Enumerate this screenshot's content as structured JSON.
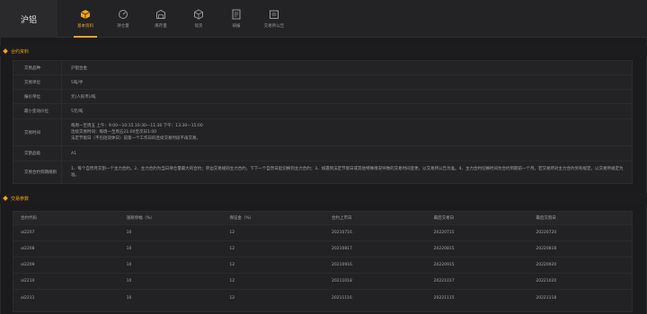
{
  "brand": {
    "title": "沪铝"
  },
  "nav": [
    {
      "label": "基本资料",
      "icon": "cube-icon",
      "active": true
    },
    {
      "label": "持仓量",
      "icon": "gauge-icon",
      "active": false
    },
    {
      "label": "库存量",
      "icon": "warehouse-icon",
      "active": false
    },
    {
      "label": "现货",
      "icon": "box-icon",
      "active": false
    },
    {
      "label": "研报",
      "icon": "document-icon",
      "active": false
    },
    {
      "label": "交易所公告",
      "icon": "notice-icon",
      "active": false
    }
  ],
  "sections": {
    "contract": "合约资料",
    "params": "交易参数"
  },
  "contract_info": [
    {
      "key": "交易品种",
      "value": "沪铝合金"
    },
    {
      "key": "交易单位",
      "value": "5吨/手"
    },
    {
      "key": "报价单位",
      "value": "元(人民币)/吨"
    },
    {
      "key": "最小变动价位",
      "value": "5元/吨"
    },
    {
      "key": "交易时间",
      "lines": [
        "每周一至周五 上午：9:00—10:15 10:30—11:30 下午：13:30—15:00",
        "连续交易时间：每周一至周五21:00至次日1:00",
        "法定节假日（不包括双休日）前第一个工作日的连续交易时段不再交易。"
      ]
    },
    {
      "key": "交割品级",
      "value": "A1"
    },
    {
      "key": "交易合约到期规则",
      "value": "1、每个自然月交割一个主力合约。2、主力合约为当日持仓量最大的合约；单边交易规则主力合约，下下一个自然日起切换到主力合约；3、如遇到法定节假日或其他特殊情况导致的交易时间变更，以交易所公告为准。4、主力合约切换时间为合约到期前一个月。若交易所对主力合约另有规定，以交易所规定为准。"
    }
  ],
  "params_table": {
    "columns": [
      "合约代码",
      "涨跌停幅（%）",
      "保证金（%）",
      "合约上市日",
      "最后交易日",
      "最后交割日"
    ],
    "rows": [
      [
        "al2207",
        "10",
        "12",
        "20210716",
        "20220715",
        "20220720"
      ],
      [
        "al2208",
        "10",
        "12",
        "20210817",
        "20220815",
        "20220818"
      ],
      [
        "al2209",
        "10",
        "12",
        "20210916",
        "20220915",
        "20220920"
      ],
      [
        "al2210",
        "10",
        "12",
        "20211018",
        "20221017",
        "20221020"
      ],
      [
        "al2211",
        "10",
        "12",
        "20211116",
        "20221115",
        "20221118"
      ]
    ]
  },
  "colors": {
    "accent": "#f2a51a",
    "bg": "#1b1b1d",
    "panel": "#232325"
  }
}
